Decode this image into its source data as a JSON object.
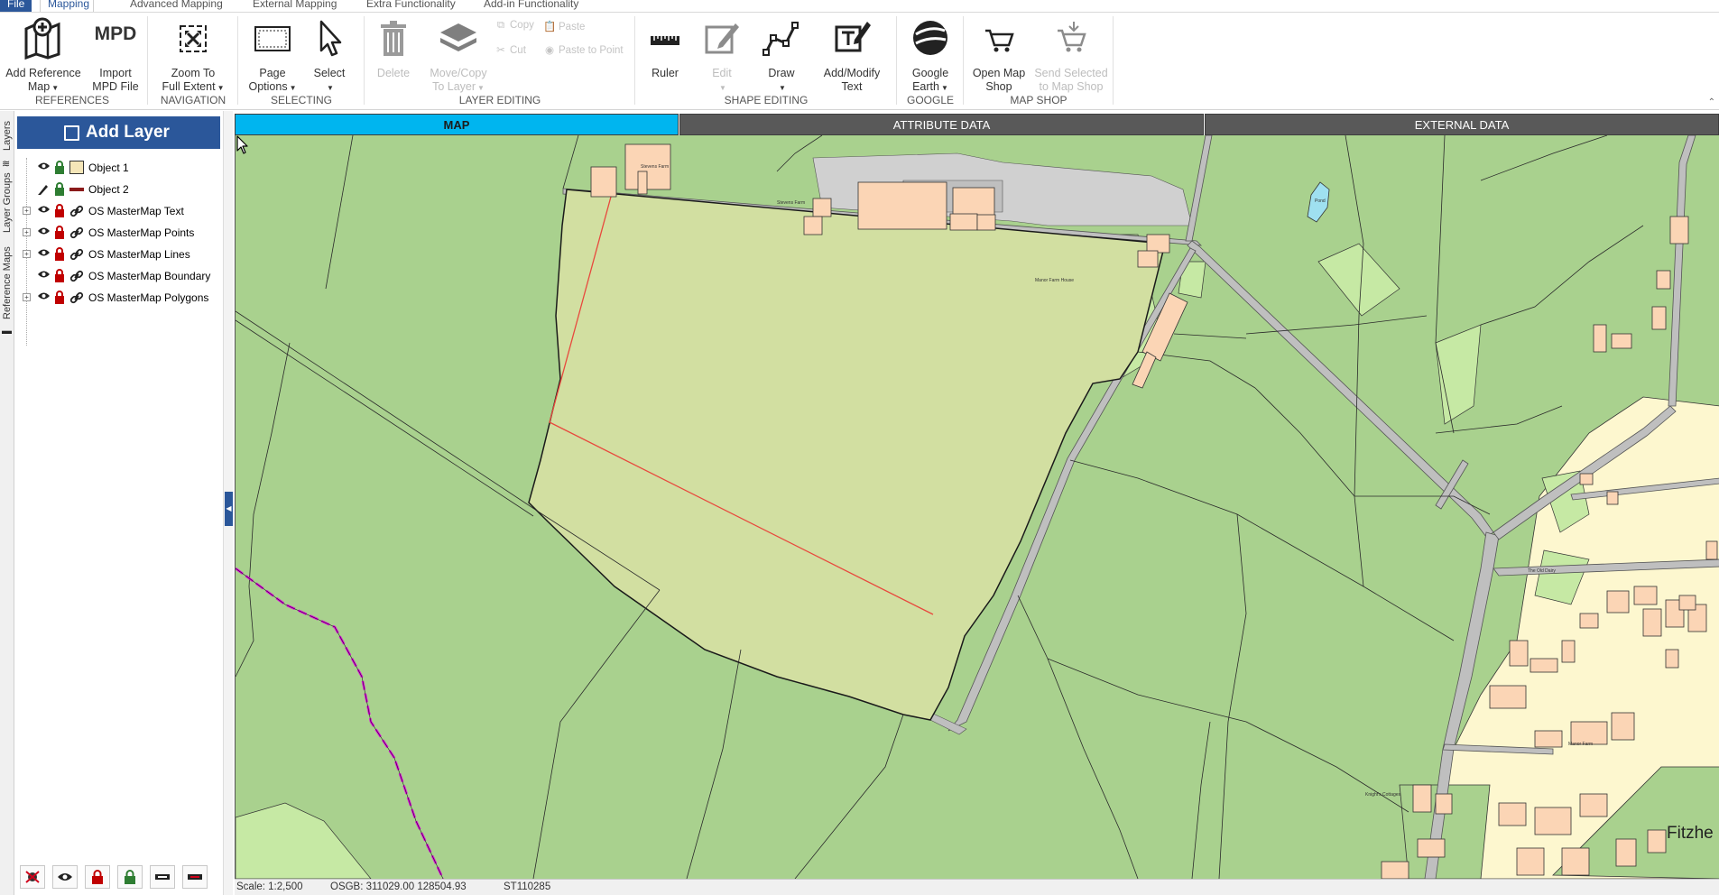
{
  "menu": {
    "tabs": [
      {
        "label": "File"
      },
      {
        "label": "Mapping"
      },
      {
        "label": "Advanced Mapping"
      },
      {
        "label": "External Mapping"
      },
      {
        "label": "Extra Functionality"
      },
      {
        "label": "Add-in Functionality"
      }
    ]
  },
  "ribbon": {
    "groups": {
      "references": "REFERENCES",
      "navigation": "NAVIGATION",
      "selecting": "SELECTING",
      "layer_editing": "LAYER EDITING",
      "shape_editing": "SHAPE EDITING",
      "google": "GOOGLE",
      "map_shop": "MAP SHOP"
    },
    "buttons": {
      "add_reference_map": [
        "Add Reference",
        "Map"
      ],
      "import_mpd": [
        "Import",
        "MPD File"
      ],
      "mpd_glyph": "MPD",
      "zoom_full": [
        "Zoom To",
        "Full Extent"
      ],
      "page_options": [
        "Page",
        "Options"
      ],
      "select": [
        "Select",
        ""
      ],
      "delete": [
        "Delete",
        ""
      ],
      "move_copy": [
        "Move/Copy",
        "To Layer"
      ],
      "copy": "Copy",
      "paste": "Paste",
      "cut": "Cut",
      "paste_to_point": "Paste to Point",
      "ruler": "Ruler",
      "edit": "Edit",
      "draw": "Draw",
      "add_modify_text": [
        "Add/Modify",
        "Text"
      ],
      "google_earth": [
        "Google",
        "Earth"
      ],
      "open_map_shop": [
        "Open Map",
        "Shop"
      ],
      "send_selected": [
        "Send Selected",
        "to Map Shop"
      ]
    }
  },
  "sidebar": {
    "tabs": [
      "Layers",
      "Layer Groups",
      "Reference Maps"
    ]
  },
  "layers_panel": {
    "add_layer_label": "Add Layer",
    "layers": [
      {
        "name": "Object 1",
        "expandable": false,
        "lock": "green",
        "symbol": "fill",
        "color": "#f5e6b8"
      },
      {
        "name": "Object 2",
        "expandable": false,
        "lock": "green",
        "symbol": "line",
        "color": "#8b1a1a"
      },
      {
        "name": "OS MasterMap Text",
        "expandable": true,
        "lock": "red",
        "symbol": "link"
      },
      {
        "name": "OS MasterMap Points",
        "expandable": true,
        "lock": "red",
        "symbol": "link"
      },
      {
        "name": "OS MasterMap Lines",
        "expandable": true,
        "lock": "red",
        "symbol": "link"
      },
      {
        "name": "OS MasterMap Boundary",
        "expandable": false,
        "lock": "red",
        "symbol": "link"
      },
      {
        "name": "OS MasterMap Polygons",
        "expandable": true,
        "lock": "red",
        "symbol": "link"
      }
    ]
  },
  "view_tabs": {
    "map": "MAP",
    "attribute": "ATTRIBUTE DATA",
    "external": "EXTERNAL DATA"
  },
  "map": {
    "place_name": "Fitzhe",
    "labels": {
      "stevens_farm": "Stevens Farm",
      "manor_farm_house": "Manor Farm House",
      "pond": "Pond",
      "manor_farm": "Manor Farm",
      "the_old_dairy": "The Old Dairy",
      "knights_cottages": "Knight's Cottages"
    },
    "colors": {
      "field": "#a9d18e",
      "selected_field": "#d2dfa1",
      "building": "#fbd5b5",
      "settlement": "#fdf7cf",
      "road": "#bfbfbf",
      "selection_line": "#e8483d",
      "boundary_magenta": "#e100e1"
    }
  },
  "status": {
    "scale": "Scale: 1:2,500",
    "coords": "OSGB: 311029.00  128504.93",
    "grid_ref": "ST110285"
  }
}
